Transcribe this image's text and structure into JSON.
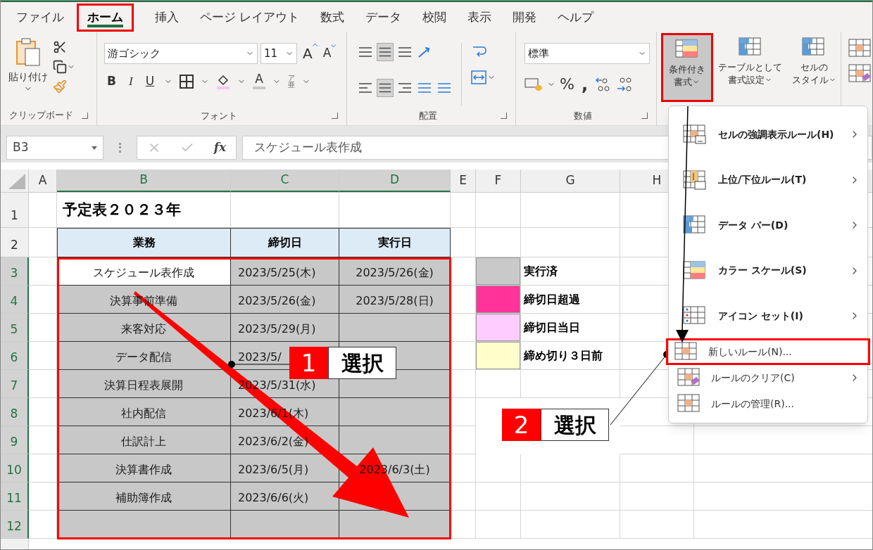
{
  "tabs": [
    {
      "label": "ファイル",
      "selected": false
    },
    {
      "label": "ホーム",
      "selected": true
    },
    {
      "label": "挿入",
      "selected": false
    },
    {
      "label": "ページ レイアウト",
      "selected": false
    },
    {
      "label": "数式",
      "selected": false
    },
    {
      "label": "データ",
      "selected": false
    },
    {
      "label": "校閲",
      "selected": false
    },
    {
      "label": "表示",
      "selected": false
    },
    {
      "label": "開発",
      "selected": false
    },
    {
      "label": "ヘルプ",
      "selected": false
    }
  ],
  "ribbon": {
    "clipboard": {
      "label": "クリップボード",
      "paste": "貼り付け"
    },
    "font": {
      "label": "フォント",
      "font_name": "游ゴシック",
      "font_size": "11",
      "grow": "A",
      "shrink": "A",
      "bold": "B",
      "italic": "I",
      "underline": "U",
      "font_color_label": "A",
      "phonetic_top": "ア",
      "phonetic_bottom": "亜"
    },
    "alignment": {
      "label": "配置"
    },
    "number": {
      "label": "数値",
      "format": "標準",
      "percent": "%",
      "comma": ","
    },
    "styles": [
      {
        "line1": "条件付き",
        "line2": "書式",
        "selected": true
      },
      {
        "line1": "テーブルとして",
        "line2": "書式設定",
        "selected": false
      },
      {
        "line1": "セルの",
        "line2": "スタイル",
        "selected": false
      }
    ]
  },
  "formula_bar": {
    "name_box": "B3",
    "fx": "fx",
    "value": "スケジュール表作成"
  },
  "columns": [
    {
      "label": "A",
      "selected": false
    },
    {
      "label": "B",
      "selected": true
    },
    {
      "label": "C",
      "selected": true
    },
    {
      "label": "D",
      "selected": true
    },
    {
      "label": "E",
      "selected": false
    },
    {
      "label": "F",
      "selected": false
    },
    {
      "label": "G",
      "selected": false
    },
    {
      "label": "H",
      "selected": false
    }
  ],
  "rows": [
    {
      "header": "1",
      "selected": false,
      "cells": [
        {
          "kind": "plain"
        },
        {
          "kind": "title",
          "text": "予定表２０２３年"
        },
        {
          "kind": "plain"
        },
        {
          "kind": "plain"
        },
        {
          "kind": "plain"
        },
        {
          "kind": "plain"
        },
        {
          "kind": "plain"
        },
        {
          "kind": "plain"
        }
      ]
    },
    {
      "header": "2",
      "selected": false,
      "cells": [
        {
          "kind": "plain"
        },
        {
          "kind": "header",
          "text": "業務"
        },
        {
          "kind": "header",
          "text": "締切日"
        },
        {
          "kind": "header",
          "text": "実行日"
        },
        {
          "kind": "plain"
        },
        {
          "kind": "plain"
        },
        {
          "kind": "plain"
        },
        {
          "kind": "plain"
        }
      ]
    },
    {
      "header": "3",
      "selected": true,
      "cells": [
        {
          "kind": "plain"
        },
        {
          "kind": "data",
          "text": "スケジュール表作成",
          "active": true
        },
        {
          "kind": "data",
          "text": "2023/5/25(木)",
          "active": false
        },
        {
          "kind": "data",
          "text": "2023/5/26(金)",
          "active": false
        },
        {
          "kind": "plain"
        },
        {
          "kind": "swatch",
          "color": "#c9c9c9"
        },
        {
          "kind": "legend",
          "text": "実行済"
        },
        {
          "kind": "plain"
        }
      ]
    },
    {
      "header": "4",
      "selected": true,
      "cells": [
        {
          "kind": "plain"
        },
        {
          "kind": "data",
          "text": "決算事前準備",
          "active": false
        },
        {
          "kind": "data",
          "text": "2023/5/26(金)",
          "active": false
        },
        {
          "kind": "data",
          "text": "2023/5/28(日)",
          "active": false
        },
        {
          "kind": "plain"
        },
        {
          "kind": "swatch",
          "color": "#ff3399"
        },
        {
          "kind": "legend",
          "text": "締切日超過"
        },
        {
          "kind": "plain"
        }
      ]
    },
    {
      "header": "5",
      "selected": true,
      "cells": [
        {
          "kind": "plain"
        },
        {
          "kind": "data",
          "text": "来客対応",
          "active": false
        },
        {
          "kind": "data",
          "text": "2023/5/29(月)",
          "active": false
        },
        {
          "kind": "data",
          "active": false
        },
        {
          "kind": "plain"
        },
        {
          "kind": "swatch",
          "color": "#ffccff"
        },
        {
          "kind": "legend",
          "text": "締切日当日"
        },
        {
          "kind": "plain"
        }
      ]
    },
    {
      "header": "6",
      "selected": true,
      "cells": [
        {
          "kind": "plain"
        },
        {
          "kind": "data",
          "text": "データ配信",
          "active": false
        },
        {
          "kind": "data",
          "text": "2023/5/",
          "active": false
        },
        {
          "kind": "data",
          "active": false
        },
        {
          "kind": "plain"
        },
        {
          "kind": "swatch",
          "color": "#ffffcc"
        },
        {
          "kind": "legend",
          "text": "締め切り３日前"
        },
        {
          "kind": "plain"
        }
      ]
    },
    {
      "header": "7",
      "selected": true,
      "cells": [
        {
          "kind": "plain"
        },
        {
          "kind": "data",
          "text": "決算日程表展開",
          "active": false
        },
        {
          "kind": "data",
          "text": "2023/5/31(水)",
          "active": false
        },
        {
          "kind": "data",
          "active": false
        },
        {
          "kind": "plain"
        },
        {
          "kind": "plain"
        },
        {
          "kind": "plain"
        },
        {
          "kind": "plain"
        }
      ]
    },
    {
      "header": "8",
      "selected": true,
      "cells": [
        {
          "kind": "plain"
        },
        {
          "kind": "data",
          "text": "社内配信",
          "active": false
        },
        {
          "kind": "data",
          "text": "2023/6/1(木)",
          "active": false
        },
        {
          "kind": "data",
          "active": false
        },
        {
          "kind": "plain"
        },
        {
          "kind": "plain"
        },
        {
          "kind": "plain"
        },
        {
          "kind": "plain"
        }
      ]
    },
    {
      "header": "9",
      "selected": true,
      "cells": [
        {
          "kind": "plain"
        },
        {
          "kind": "data",
          "text": "仕訳計上",
          "active": false
        },
        {
          "kind": "data",
          "text": "2023/6/2(金)",
          "active": false
        },
        {
          "kind": "data",
          "active": false
        },
        {
          "kind": "plain"
        },
        {
          "kind": "plain"
        },
        {
          "kind": "plain"
        },
        {
          "kind": "plain"
        }
      ]
    },
    {
      "header": "10",
      "selected": true,
      "cells": [
        {
          "kind": "plain"
        },
        {
          "kind": "data",
          "text": "決算書作成",
          "active": false
        },
        {
          "kind": "data",
          "text": "2023/6/5(月)",
          "active": false
        },
        {
          "kind": "data",
          "text": "2023/6/3(土)",
          "active": false
        },
        {
          "kind": "plain"
        },
        {
          "kind": "plain"
        },
        {
          "kind": "plain"
        },
        {
          "kind": "plain"
        }
      ]
    },
    {
      "header": "11",
      "selected": true,
      "cells": [
        {
          "kind": "plain"
        },
        {
          "kind": "data",
          "text": "補助簿作成",
          "active": false
        },
        {
          "kind": "data",
          "text": "2023/6/6(火)",
          "active": false
        },
        {
          "kind": "data",
          "active": false
        },
        {
          "kind": "plain"
        },
        {
          "kind": "plain"
        },
        {
          "kind": "plain"
        },
        {
          "kind": "plain"
        }
      ]
    },
    {
      "header": "12",
      "selected": true,
      "cells": [
        {
          "kind": "plain"
        },
        {
          "kind": "data",
          "active": false
        },
        {
          "kind": "data",
          "active": false
        },
        {
          "kind": "data",
          "active": false
        },
        {
          "kind": "plain"
        },
        {
          "kind": "plain"
        },
        {
          "kind": "plain"
        },
        {
          "kind": "plain"
        }
      ]
    }
  ],
  "menu": [
    {
      "kind": "large",
      "label": "セルの強調表示ルール(H)",
      "submenu": true,
      "selected": false
    },
    {
      "kind": "large",
      "label": "上位/下位ルール(T)",
      "submenu": true,
      "selected": false
    },
    {
      "kind": "large",
      "label": "データ バー(D)",
      "submenu": true,
      "selected": false
    },
    {
      "kind": "large",
      "label": "カラー スケール(S)",
      "submenu": true,
      "selected": false
    },
    {
      "kind": "large",
      "label": "アイコン セット(I)",
      "submenu": true,
      "selected": false
    },
    {
      "kind": "small",
      "label": "新しいルール(N)...",
      "submenu": false,
      "selected": true
    },
    {
      "kind": "small",
      "label": "ルールのクリア(C)",
      "submenu": true,
      "selected": false
    },
    {
      "kind": "small",
      "label": "ルールの管理(R)...",
      "submenu": false,
      "selected": false
    }
  ],
  "callouts": [
    {
      "number": "1",
      "label": "選択"
    },
    {
      "number": "2",
      "label": "選択"
    }
  ]
}
